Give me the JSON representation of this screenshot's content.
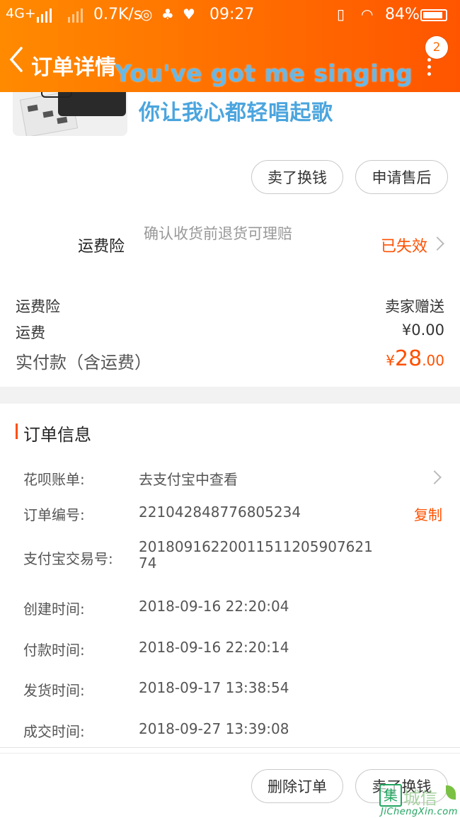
{
  "status_bar": {
    "network": "4G+",
    "speed": "0.7K/s",
    "time": "09:27",
    "battery": "84%"
  },
  "nav": {
    "title": "订单详情",
    "badge_count": "2",
    "accent_color": "#ff6a00"
  },
  "overlay_lyrics": {
    "english": "You've got me singing",
    "chinese": "你让我心都轻唱起歌"
  },
  "product": {
    "sell_button": "卖了换钱",
    "after_sale_button": "申请售后"
  },
  "shipping_insurance": {
    "label": "运费险",
    "description": "确认收货前退货可理赔",
    "status": "已失效",
    "status_color": "#ff5000"
  },
  "cost": {
    "rows": [
      {
        "label": "运费险",
        "value": "卖家赠送"
      },
      {
        "label": "运费",
        "value": "¥0.00"
      }
    ],
    "total_label": "实付款（含运费）",
    "total_currency": "¥",
    "total_integer": "28",
    "total_decimal": ".00"
  },
  "order_info": {
    "section_title": "订单信息",
    "huabei_label": "花呗账单:",
    "huabei_value": "去支付宝中查看",
    "order_no_label": "订单编号:",
    "order_no": "2210428487768052​34",
    "copy_label": "复制",
    "alipay_label": "支付宝交易号:",
    "alipay_no": "2018091622001151120590762174",
    "times": [
      {
        "label": "创建时间:",
        "value": "2018-09-16 22:20:04"
      },
      {
        "label": "付款时间:",
        "value": "2018-09-16 22:20:14"
      },
      {
        "label": "发货时间:",
        "value": "2018-09-17 13:38:54"
      },
      {
        "label": "成交时间:",
        "value": "2018-09-27 13:39:08"
      }
    ]
  },
  "footer": {
    "delete_button": "删除订单",
    "sell_button": "卖了换钱"
  },
  "watermark": {
    "mark": "集",
    "name": "城信",
    "url": "JiChengXin.com"
  }
}
